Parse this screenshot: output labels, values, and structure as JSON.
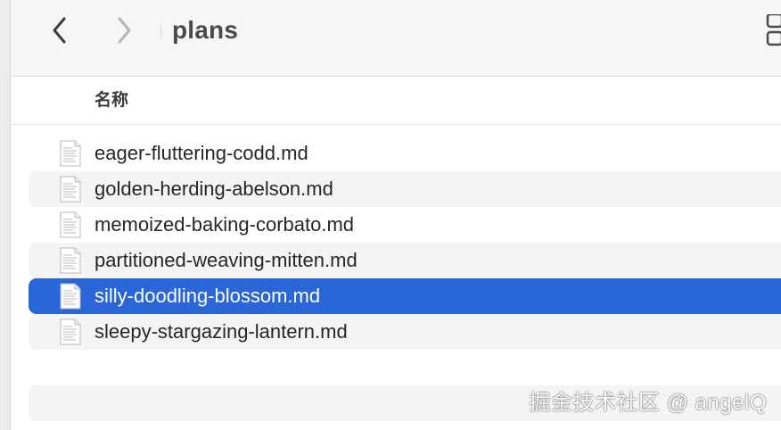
{
  "window": {
    "title": "plans"
  },
  "toolbar": {
    "back_icon": "chevron-left-icon",
    "forward_icon": "chevron-right-icon",
    "view_icon": "view-grid-icon"
  },
  "columns": {
    "name_header": "名称"
  },
  "files": [
    {
      "name": "eager-fluttering-codd.md",
      "icon": "markdown-file-icon",
      "selected": false
    },
    {
      "name": "golden-herding-abelson.md",
      "icon": "markdown-file-icon",
      "selected": false
    },
    {
      "name": "memoized-baking-corbato.md",
      "icon": "markdown-file-icon",
      "selected": false
    },
    {
      "name": "partitioned-weaving-mitten.md",
      "icon": "markdown-file-icon",
      "selected": false
    },
    {
      "name": "silly-doodling-blossom.md",
      "icon": "markdown-file-icon",
      "selected": true
    },
    {
      "name": "sleepy-stargazing-lantern.md",
      "icon": "markdown-file-icon",
      "selected": false
    }
  ],
  "watermark": {
    "text": "掘金技术社区 @ angelQ"
  },
  "colors": {
    "selection": "#2a66d8",
    "alt_row": "#f4f4f5",
    "toolbar_bg": "#f6f6f6"
  }
}
